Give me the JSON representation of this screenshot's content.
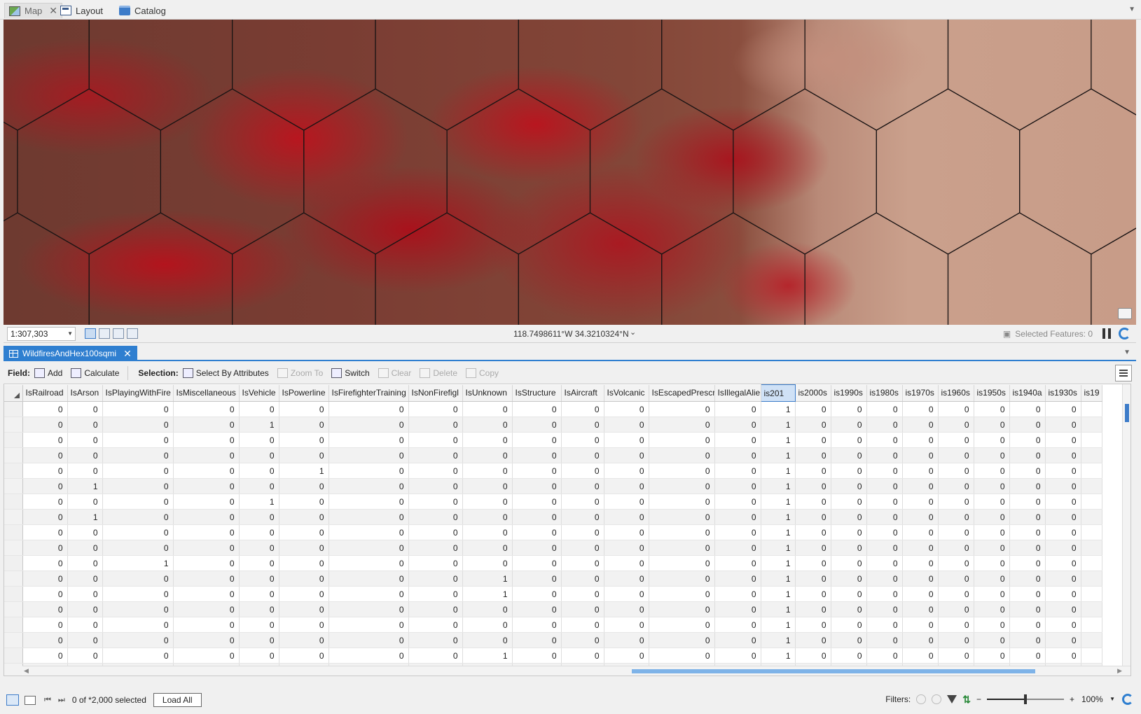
{
  "top_tabs": [
    {
      "label": "Map",
      "icon": "map-icon",
      "active": true,
      "closable": true
    },
    {
      "label": "Layout",
      "icon": "layout-icon",
      "active": false,
      "closable": false
    },
    {
      "label": "Catalog",
      "icon": "catalog-icon",
      "active": false,
      "closable": false
    }
  ],
  "map_status": {
    "scale": "1:307,303",
    "coordinates": "118.7498611°W 34.3210324°N",
    "selected_features": "Selected Features: 0"
  },
  "table_tab": {
    "label": "WildfiresAndHex100sqmi"
  },
  "table_toolbar": {
    "field_label": "Field:",
    "add": "Add",
    "calculate": "Calculate",
    "selection_label": "Selection:",
    "select_by_attributes": "Select By Attributes",
    "zoom_to": "Zoom To",
    "switch": "Switch",
    "clear": "Clear",
    "delete": "Delete",
    "copy": "Copy"
  },
  "columns": [
    {
      "name": "IsRailroad",
      "width": 64
    },
    {
      "name": "IsArson",
      "width": 50
    },
    {
      "name": "IsPlayingWithFire",
      "width": 101
    },
    {
      "name": "IsMiscellaneous",
      "width": 94
    },
    {
      "name": "IsVehicle",
      "width": 57
    },
    {
      "name": "IsPowerline",
      "width": 71
    },
    {
      "name": "IsFirefighterTraining",
      "width": 114
    },
    {
      "name": "IsNonFirefigl",
      "width": 77
    },
    {
      "name": "IsUnknown",
      "width": 71
    },
    {
      "name": "IsStructure",
      "width": 70
    },
    {
      "name": "IsAircraft",
      "width": 61
    },
    {
      "name": "IsVolcanic",
      "width": 64
    },
    {
      "name": "IsEscapedPrescr",
      "width": 94
    },
    {
      "name": "IsIllegalAlie",
      "width": 66
    },
    {
      "name": "is201",
      "width": 49,
      "sorted": true
    },
    {
      "name": "is2000s",
      "width": 51
    },
    {
      "name": "is1990s",
      "width": 51
    },
    {
      "name": "is1980s",
      "width": 51
    },
    {
      "name": "is1970s",
      "width": 51
    },
    {
      "name": "is1960s",
      "width": 51
    },
    {
      "name": "is1950s",
      "width": 51
    },
    {
      "name": "is1940a",
      "width": 51
    },
    {
      "name": "is1930s",
      "width": 51
    },
    {
      "name": "is19",
      "width": 30
    }
  ],
  "rows": [
    [
      "0",
      "0",
      "0",
      "0",
      "0",
      "0",
      "0",
      "0",
      "0",
      "0",
      "0",
      "0",
      "0",
      "0",
      "1",
      "0",
      "0",
      "0",
      "0",
      "0",
      "0",
      "0",
      "0",
      ""
    ],
    [
      "0",
      "0",
      "0",
      "0",
      "1",
      "0",
      "0",
      "0",
      "0",
      "0",
      "0",
      "0",
      "0",
      "0",
      "1",
      "0",
      "0",
      "0",
      "0",
      "0",
      "0",
      "0",
      "0",
      ""
    ],
    [
      "0",
      "0",
      "0",
      "0",
      "0",
      "0",
      "0",
      "0",
      "0",
      "0",
      "0",
      "0",
      "0",
      "0",
      "1",
      "0",
      "0",
      "0",
      "0",
      "0",
      "0",
      "0",
      "0",
      ""
    ],
    [
      "0",
      "0",
      "0",
      "0",
      "0",
      "0",
      "0",
      "0",
      "0",
      "0",
      "0",
      "0",
      "0",
      "0",
      "1",
      "0",
      "0",
      "0",
      "0",
      "0",
      "0",
      "0",
      "0",
      ""
    ],
    [
      "0",
      "0",
      "0",
      "0",
      "0",
      "1",
      "0",
      "0",
      "0",
      "0",
      "0",
      "0",
      "0",
      "0",
      "1",
      "0",
      "0",
      "0",
      "0",
      "0",
      "0",
      "0",
      "0",
      ""
    ],
    [
      "0",
      "1",
      "0",
      "0",
      "0",
      "0",
      "0",
      "0",
      "0",
      "0",
      "0",
      "0",
      "0",
      "0",
      "1",
      "0",
      "0",
      "0",
      "0",
      "0",
      "0",
      "0",
      "0",
      ""
    ],
    [
      "0",
      "0",
      "0",
      "0",
      "1",
      "0",
      "0",
      "0",
      "0",
      "0",
      "0",
      "0",
      "0",
      "0",
      "1",
      "0",
      "0",
      "0",
      "0",
      "0",
      "0",
      "0",
      "0",
      ""
    ],
    [
      "0",
      "1",
      "0",
      "0",
      "0",
      "0",
      "0",
      "0",
      "0",
      "0",
      "0",
      "0",
      "0",
      "0",
      "1",
      "0",
      "0",
      "0",
      "0",
      "0",
      "0",
      "0",
      "0",
      ""
    ],
    [
      "0",
      "0",
      "0",
      "0",
      "0",
      "0",
      "0",
      "0",
      "0",
      "0",
      "0",
      "0",
      "0",
      "0",
      "1",
      "0",
      "0",
      "0",
      "0",
      "0",
      "0",
      "0",
      "0",
      ""
    ],
    [
      "0",
      "0",
      "0",
      "0",
      "0",
      "0",
      "0",
      "0",
      "0",
      "0",
      "0",
      "0",
      "0",
      "0",
      "1",
      "0",
      "0",
      "0",
      "0",
      "0",
      "0",
      "0",
      "0",
      ""
    ],
    [
      "0",
      "0",
      "1",
      "0",
      "0",
      "0",
      "0",
      "0",
      "0",
      "0",
      "0",
      "0",
      "0",
      "0",
      "1",
      "0",
      "0",
      "0",
      "0",
      "0",
      "0",
      "0",
      "0",
      ""
    ],
    [
      "0",
      "0",
      "0",
      "0",
      "0",
      "0",
      "0",
      "0",
      "1",
      "0",
      "0",
      "0",
      "0",
      "0",
      "1",
      "0",
      "0",
      "0",
      "0",
      "0",
      "0",
      "0",
      "0",
      ""
    ],
    [
      "0",
      "0",
      "0",
      "0",
      "0",
      "0",
      "0",
      "0",
      "1",
      "0",
      "0",
      "0",
      "0",
      "0",
      "1",
      "0",
      "0",
      "0",
      "0",
      "0",
      "0",
      "0",
      "0",
      ""
    ],
    [
      "0",
      "0",
      "0",
      "0",
      "0",
      "0",
      "0",
      "0",
      "0",
      "0",
      "0",
      "0",
      "0",
      "0",
      "1",
      "0",
      "0",
      "0",
      "0",
      "0",
      "0",
      "0",
      "0",
      ""
    ],
    [
      "0",
      "0",
      "0",
      "0",
      "0",
      "0",
      "0",
      "0",
      "0",
      "0",
      "0",
      "0",
      "0",
      "0",
      "1",
      "0",
      "0",
      "0",
      "0",
      "0",
      "0",
      "0",
      "0",
      ""
    ],
    [
      "0",
      "0",
      "0",
      "0",
      "0",
      "0",
      "0",
      "0",
      "0",
      "0",
      "0",
      "0",
      "0",
      "0",
      "1",
      "0",
      "0",
      "0",
      "0",
      "0",
      "0",
      "0",
      "0",
      ""
    ],
    [
      "0",
      "0",
      "0",
      "0",
      "0",
      "0",
      "0",
      "0",
      "1",
      "0",
      "0",
      "0",
      "0",
      "0",
      "1",
      "0",
      "0",
      "0",
      "0",
      "0",
      "0",
      "0",
      "0",
      ""
    ],
    [
      "0",
      "0",
      "0",
      "0",
      "0",
      "0",
      "0",
      "0",
      "1",
      "0",
      "0",
      "0",
      "0",
      "0",
      "1",
      "0",
      "0",
      "0",
      "0",
      "0",
      "0",
      "0",
      "0",
      ""
    ]
  ],
  "bottom_status": {
    "selected_count": "0 of *2,000 selected",
    "load_all": "Load All",
    "filters_label": "Filters:",
    "zoom": "100%",
    "zoom_fraction": 0.5
  }
}
